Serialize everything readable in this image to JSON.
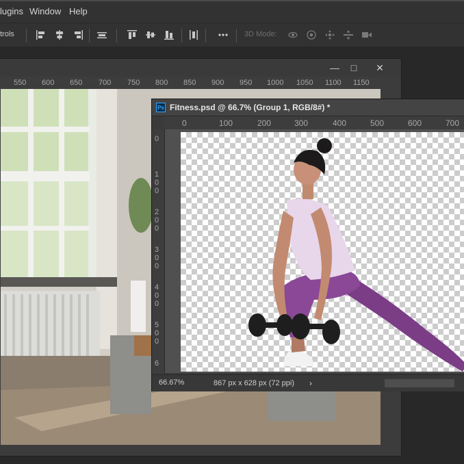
{
  "menu": {
    "items": [
      "lugins",
      "Window",
      "Help"
    ]
  },
  "options_bar": {
    "label": "trols",
    "mode_label": "3D Mode:"
  },
  "back_window": {
    "ruler": [
      "550",
      "600",
      "650",
      "700",
      "750",
      "800",
      "850",
      "900",
      "950",
      "1000",
      "1050",
      "1100",
      "1150"
    ]
  },
  "document": {
    "title": "Fitness.psd @ 66.7% (Group 1, RGB/8#) *",
    "h_ruler": [
      "0",
      "100",
      "200",
      "300",
      "400",
      "500",
      "600",
      "700"
    ],
    "v_ruler": [
      "0",
      "100",
      "200",
      "300",
      "400",
      "500",
      "6"
    ],
    "zoom": "66.67%",
    "dimensions": "867 px x 628 px (72 ppi)"
  },
  "icons": [
    "minimize-icon",
    "maximize-icon",
    "close-icon",
    "photoshop-logo-icon",
    "align-left-icon",
    "align-center-icon",
    "align-right-icon",
    "distribute-icon",
    "more-icon",
    "orbit-icon",
    "roll-icon",
    "pan-icon",
    "slide-icon",
    "camera-icon"
  ]
}
